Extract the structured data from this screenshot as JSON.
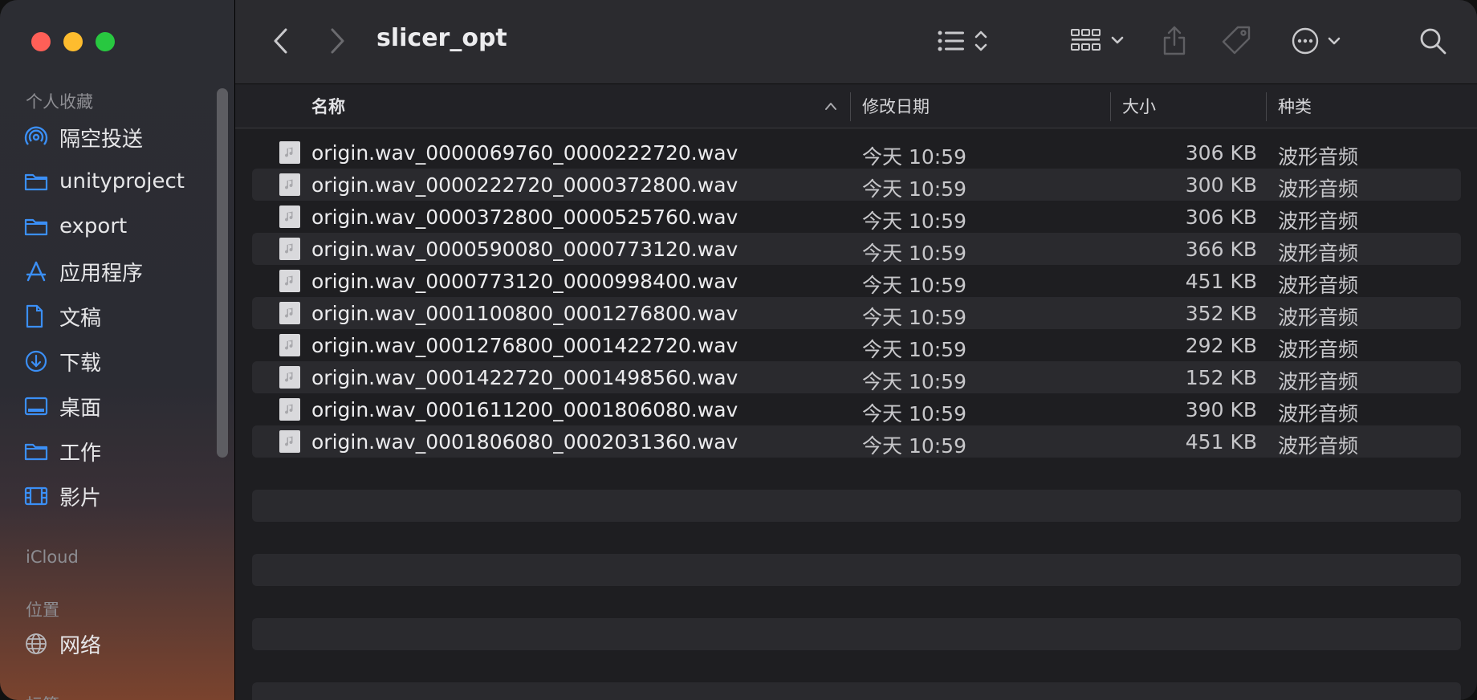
{
  "window": {
    "title": "slicer_opt"
  },
  "sidebar": {
    "favorites_header": "个人收藏",
    "favorites": [
      {
        "label": "隔空投送",
        "icon": "airdrop-icon"
      },
      {
        "label": "unityproject",
        "icon": "folder-icon"
      },
      {
        "label": "export",
        "icon": "folder-icon"
      },
      {
        "label": "应用程序",
        "icon": "applications-icon"
      },
      {
        "label": "文稿",
        "icon": "document-icon"
      },
      {
        "label": "下载",
        "icon": "download-icon"
      },
      {
        "label": "桌面",
        "icon": "desktop-icon"
      },
      {
        "label": "工作",
        "icon": "folder-icon"
      },
      {
        "label": "影片",
        "icon": "film-icon"
      }
    ],
    "icloud_header": "iCloud",
    "locations_header": "位置",
    "locations": [
      {
        "label": "网络",
        "icon": "globe-icon"
      }
    ],
    "tags_header": "标签"
  },
  "columns": {
    "name": "名称",
    "date": "修改日期",
    "size": "大小",
    "kind": "种类"
  },
  "files": [
    {
      "name": "origin.wav_0000069760_0000222720.wav",
      "date": "今天 10:59",
      "size": "306 KB",
      "kind": "波形音频"
    },
    {
      "name": "origin.wav_0000222720_0000372800.wav",
      "date": "今天 10:59",
      "size": "300 KB",
      "kind": "波形音频"
    },
    {
      "name": "origin.wav_0000372800_0000525760.wav",
      "date": "今天 10:59",
      "size": "306 KB",
      "kind": "波形音频"
    },
    {
      "name": "origin.wav_0000590080_0000773120.wav",
      "date": "今天 10:59",
      "size": "366 KB",
      "kind": "波形音频"
    },
    {
      "name": "origin.wav_0000773120_0000998400.wav",
      "date": "今天 10:59",
      "size": "451 KB",
      "kind": "波形音频"
    },
    {
      "name": "origin.wav_0001100800_0001276800.wav",
      "date": "今天 10:59",
      "size": "352 KB",
      "kind": "波形音频"
    },
    {
      "name": "origin.wav_0001276800_0001422720.wav",
      "date": "今天 10:59",
      "size": "292 KB",
      "kind": "波形音频"
    },
    {
      "name": "origin.wav_0001422720_0001498560.wav",
      "date": "今天 10:59",
      "size": "152 KB",
      "kind": "波形音频"
    },
    {
      "name": "origin.wav_0001611200_0001806080.wav",
      "date": "今天 10:59",
      "size": "390 KB",
      "kind": "波形音频"
    },
    {
      "name": "origin.wav_0001806080_0002031360.wav",
      "date": "今天 10:59",
      "size": "451 KB",
      "kind": "波形音频"
    }
  ]
}
